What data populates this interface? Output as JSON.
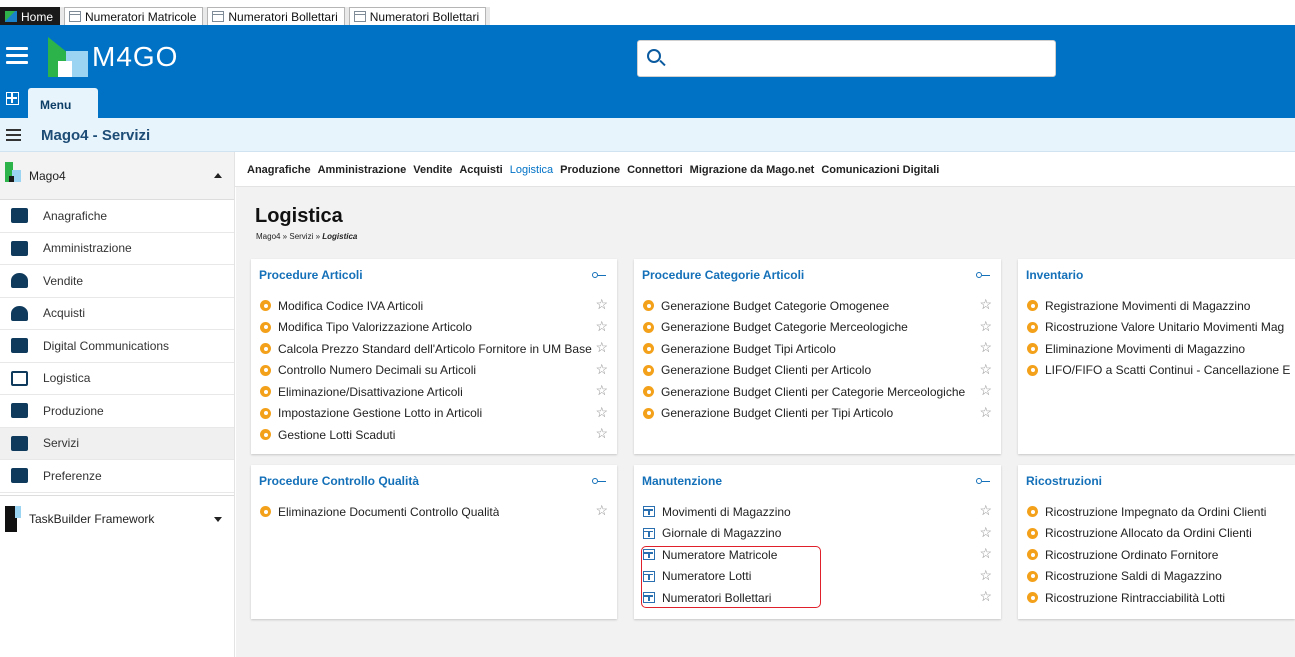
{
  "window_tabs": [
    {
      "label": "Home",
      "type": "home"
    },
    {
      "label": "Numeratori Matricole",
      "type": "doc"
    },
    {
      "label": "Numeratori Bollettari",
      "type": "doc"
    },
    {
      "label": "Numeratori Bollettari",
      "type": "doc"
    }
  ],
  "header": {
    "logo_text": "M4GO",
    "search_placeholder": "",
    "menu_tab_label": "Menu",
    "brand_color": "#0072c6"
  },
  "titlebar": {
    "title": "Mago4 - Servizi"
  },
  "sidebar": {
    "group_label": "Mago4",
    "items": [
      {
        "label": "Anagrafiche",
        "icon": "contact-card-icon"
      },
      {
        "label": "Amministrazione",
        "icon": "bar-chart-icon"
      },
      {
        "label": "Vendite",
        "icon": "cash-register-icon"
      },
      {
        "label": "Acquisti",
        "icon": "shopping-bag-icon"
      },
      {
        "label": "Digital Communications",
        "icon": "digital-doc-icon"
      },
      {
        "label": "Logistica",
        "icon": "box-icon"
      },
      {
        "label": "Produzione",
        "icon": "factory-icon"
      },
      {
        "label": "Servizi",
        "icon": "tools-icon",
        "active": true
      },
      {
        "label": "Preferenze",
        "icon": "preferences-icon"
      }
    ],
    "group2_label": "TaskBuilder Framework"
  },
  "topmenu": [
    {
      "label": "Anagrafiche"
    },
    {
      "label": "Amministrazione"
    },
    {
      "label": "Vendite"
    },
    {
      "label": "Acquisti"
    },
    {
      "label": "Logistica",
      "active": true
    },
    {
      "label": "Produzione"
    },
    {
      "label": "Connettori"
    },
    {
      "label": "Migrazione da Mago.net"
    },
    {
      "label": "Comunicazioni Digitali"
    }
  ],
  "page": {
    "title": "Logistica",
    "breadcrumb_prefix": "Mago4 » Servizi » ",
    "breadcrumb_current": "Logistica"
  },
  "cards": {
    "procedure_articoli": {
      "title": "Procedure Articoli",
      "items": [
        {
          "label": "Modifica Codice IVA Articoli",
          "icon": "gear"
        },
        {
          "label": "Modifica Tipo Valorizzazione Articolo",
          "icon": "gear"
        },
        {
          "label": "Calcola Prezzo Standard dell'Articolo Fornitore in UM Base",
          "icon": "gear"
        },
        {
          "label": "Controllo Numero Decimali su Articoli",
          "icon": "gear"
        },
        {
          "label": "Eliminazione/Disattivazione Articoli",
          "icon": "gear"
        },
        {
          "label": "Impostazione Gestione Lotto in Articoli",
          "icon": "gear"
        },
        {
          "label": "Gestione Lotti Scaduti",
          "icon": "gear"
        }
      ]
    },
    "procedure_categorie": {
      "title": "Procedure Categorie Articoli",
      "items": [
        {
          "label": "Generazione Budget Categorie Omogenee",
          "icon": "gear"
        },
        {
          "label": "Generazione Budget Categorie Merceologiche",
          "icon": "gear"
        },
        {
          "label": "Generazione Budget Tipi Articolo",
          "icon": "gear"
        },
        {
          "label": "Generazione Budget Clienti per Articolo",
          "icon": "gear"
        },
        {
          "label": "Generazione Budget Clienti per Categorie Merceologiche",
          "icon": "gear"
        },
        {
          "label": "Generazione Budget Clienti per Tipi Articolo",
          "icon": "gear"
        }
      ]
    },
    "inventario": {
      "title": "Inventario",
      "items": [
        {
          "label": "Registrazione Movimenti di Magazzino",
          "icon": "gear"
        },
        {
          "label": "Ricostruzione Valore Unitario Movimenti Mag",
          "icon": "gear"
        },
        {
          "label": "Eliminazione Movimenti di Magazzino",
          "icon": "gear"
        },
        {
          "label": "LIFO/FIFO a Scatti Continui - Cancellazione E",
          "icon": "gear"
        }
      ]
    },
    "controllo_qualita": {
      "title": "Procedure Controllo Qualità",
      "items": [
        {
          "label": "Eliminazione Documenti Controllo Qualità",
          "icon": "gear"
        }
      ]
    },
    "manutenzione": {
      "title": "Manutenzione",
      "items": [
        {
          "label": "Movimenti di Magazzino",
          "icon": "doc"
        },
        {
          "label": "Giornale di Magazzino",
          "icon": "doc"
        },
        {
          "label": "Numeratore Matricole",
          "icon": "doc"
        },
        {
          "label": "Numeratore Lotti",
          "icon": "doc"
        },
        {
          "label": "Numeratori Bollettari",
          "icon": "doc"
        }
      ]
    },
    "ricostruzioni": {
      "title": "Ricostruzioni",
      "items": [
        {
          "label": "Ricostruzione Impegnato da Ordini Clienti",
          "icon": "gear"
        },
        {
          "label": "Ricostruzione Allocato da Ordini Clienti",
          "icon": "gear"
        },
        {
          "label": "Ricostruzione Ordinato Fornitore",
          "icon": "gear"
        },
        {
          "label": "Ricostruzione Saldi di Magazzino",
          "icon": "gear"
        },
        {
          "label": "Ricostruzione Rintracciabilità Lotti",
          "icon": "gear"
        }
      ]
    }
  },
  "colors": {
    "accent": "#1470b8",
    "gear": "#f3a11b",
    "highlight": "#e0202a"
  }
}
